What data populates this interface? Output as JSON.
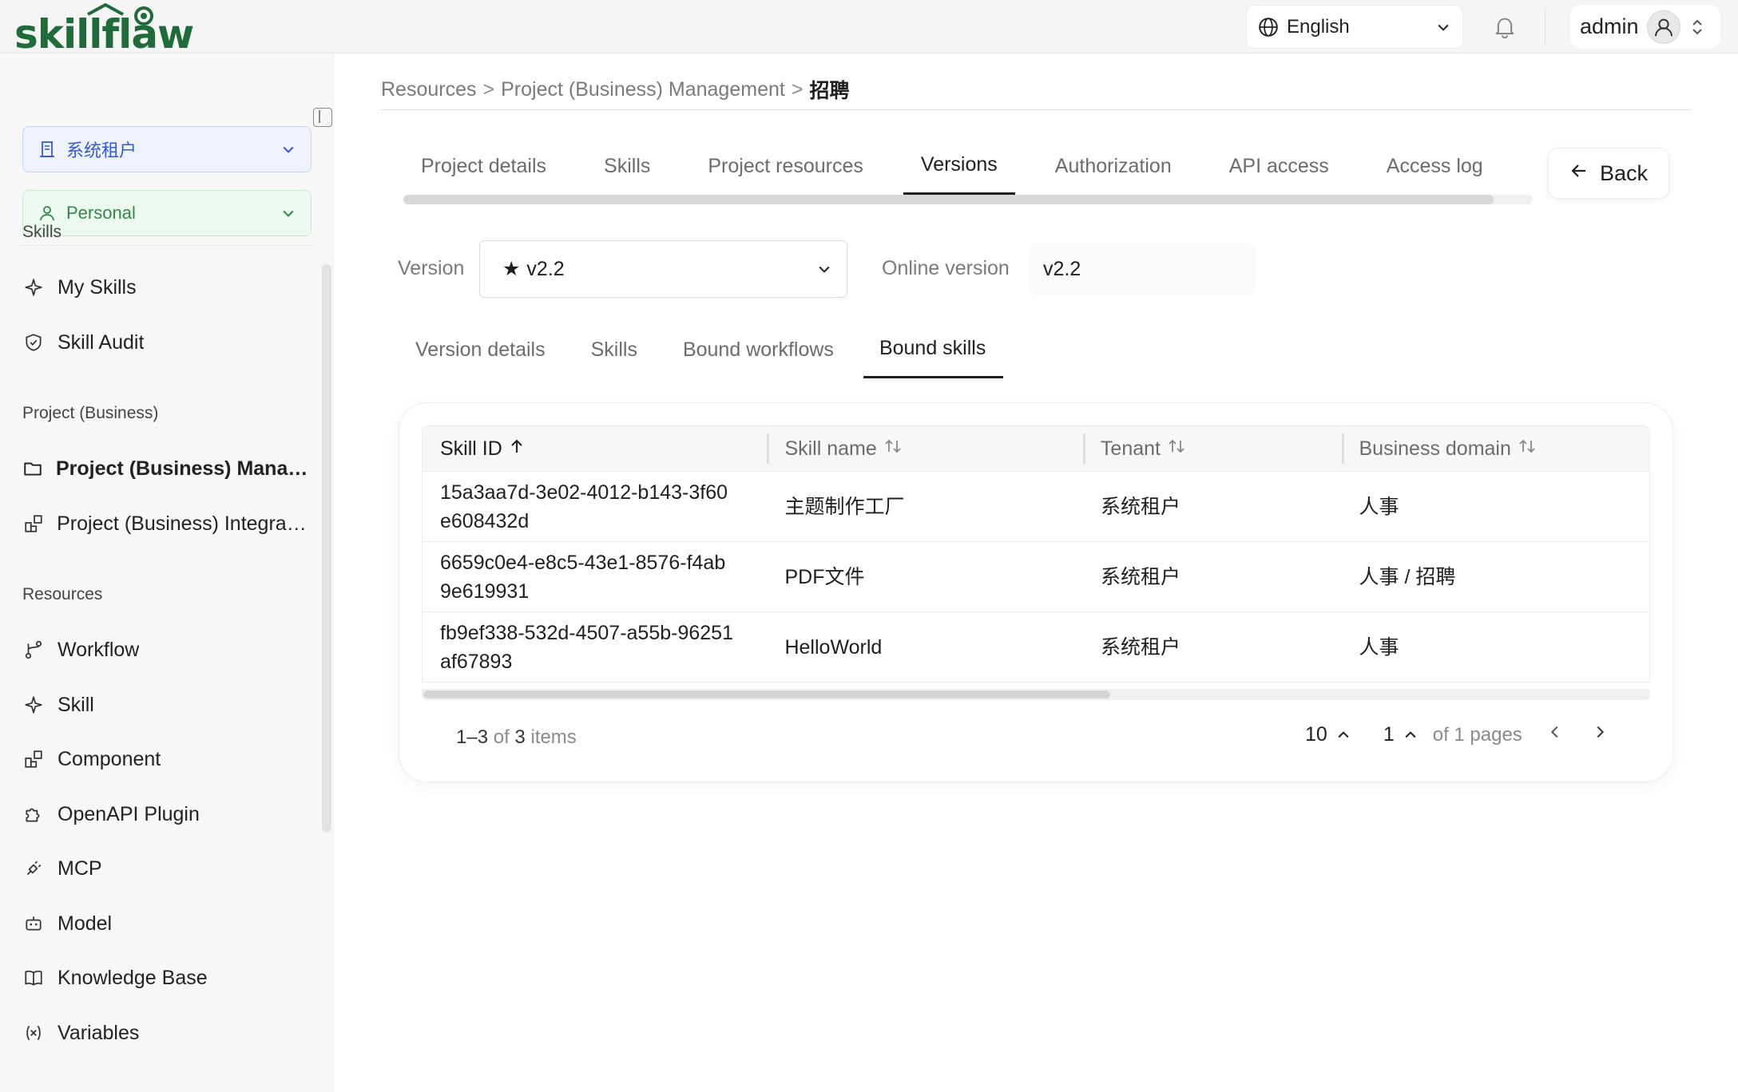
{
  "app": {
    "logo_text": "skillflaw",
    "brand_color": "#1f6b3a"
  },
  "topbar": {
    "language": "English",
    "user_name": "admin"
  },
  "sidebar": {
    "tenant_select": "系统租户",
    "personal_select": "Personal",
    "sections": [
      {
        "title": "Skills",
        "items": [
          {
            "label": "My Skills",
            "icon": "sparkle-icon"
          },
          {
            "label": "Skill Audit",
            "icon": "shield-check-icon"
          }
        ]
      },
      {
        "title": "Project (Business)",
        "items": [
          {
            "label": "Project (Business) Management",
            "icon": "folder-icon",
            "active": true
          },
          {
            "label": "Project (Business) Integration",
            "icon": "blocks-icon"
          }
        ]
      },
      {
        "title": "Resources",
        "items": [
          {
            "label": "Workflow",
            "icon": "branch-icon"
          },
          {
            "label": "Skill",
            "icon": "sparkle-icon"
          },
          {
            "label": "Component",
            "icon": "blocks-icon"
          },
          {
            "label": "OpenAPI Plugin",
            "icon": "puzzle-icon"
          },
          {
            "label": "MCP",
            "icon": "plug-icon"
          },
          {
            "label": "Model",
            "icon": "robot-icon"
          },
          {
            "label": "Knowledge Base",
            "icon": "book-icon"
          },
          {
            "label": "Variables",
            "icon": "variable-icon"
          }
        ]
      }
    ]
  },
  "breadcrumb": {
    "items": [
      "Resources",
      "Project (Business) Management"
    ],
    "current": "招聘",
    "separator": ">"
  },
  "tabs": [
    "Project details",
    "Skills",
    "Project resources",
    "Versions",
    "Authorization",
    "API access",
    "Access log"
  ],
  "active_tab": "Versions",
  "back_label": "Back",
  "version": {
    "label": "Version",
    "selected": "v2.2",
    "star": "★",
    "online_label": "Online version",
    "online_value": "v2.2"
  },
  "subtabs": [
    "Version details",
    "Skills",
    "Bound workflows",
    "Bound skills"
  ],
  "active_subtab": "Bound skills",
  "table": {
    "columns": [
      "Skill ID",
      "Skill name",
      "Tenant",
      "Business domain"
    ],
    "rows": [
      {
        "id": "15a3aa7d-3e02-4012-b143-3f60e608432d",
        "name": "主题制作工厂",
        "tenant": "系统租户",
        "domain": "人事"
      },
      {
        "id": "6659c0e4-e8c5-43e1-8576-f4ab9e619931",
        "name": "PDF文件",
        "tenant": "系统租户",
        "domain": "人事 / 招聘"
      },
      {
        "id": "fb9ef338-532d-4507-a55b-96251af67893",
        "name": "HelloWorld",
        "tenant": "系统租户",
        "domain": "人事"
      }
    ]
  },
  "pagination": {
    "range": "1–3",
    "of_word": "of",
    "total": "3",
    "items_word": "items",
    "page_size": "10",
    "page": "1",
    "pages_text": "of 1 pages"
  }
}
